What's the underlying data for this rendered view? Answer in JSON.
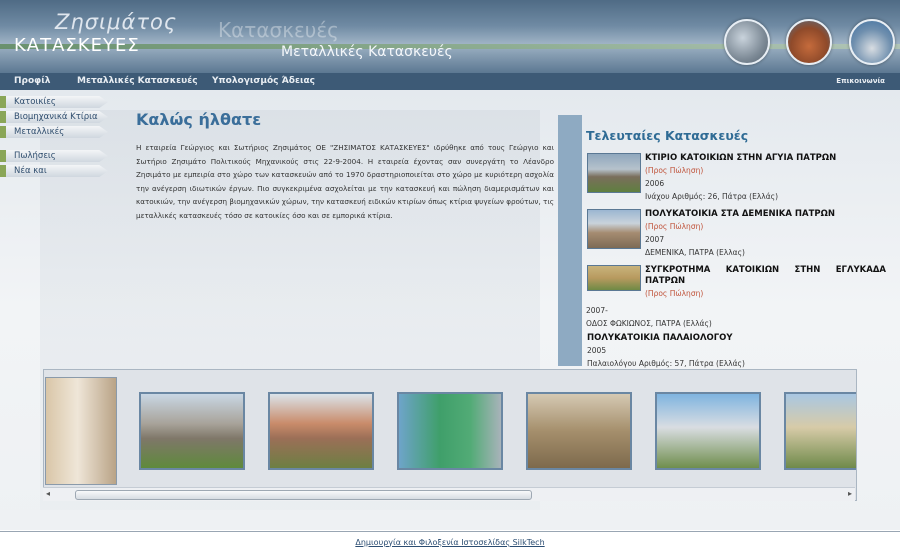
{
  "header": {
    "logo_top": "Ζησιμάτος",
    "logo_bottom": "ΚΑΤΑΣΚΕΥΕΣ",
    "ghost_title": "Κατασκευές",
    "subtitle": "Μεταλλικές Κατασκευές"
  },
  "nav": {
    "items": [
      "Προφίλ",
      "Μεταλλικές Κατασκευές",
      "Υπολογισμός Άδειας"
    ],
    "contact": "Επικοινωνία"
  },
  "sidebar": {
    "items": [
      "Κατοικίες",
      "Βιομηχανικά Κτίρια",
      "Μεταλλικές Κατασκευές",
      "Πωλήσεις",
      "Νέα και Ανακοινώσεις"
    ]
  },
  "main": {
    "title": "Καλώς ήλθατε",
    "body": "Η εταιρεία Γεώργιος και Σωτήριος Ζησιμάτος ΟΕ \"ΖΗΣΙΜΑΤΟΣ ΚΑΤΑΣΚΕΥΕΣ\" ιδρύθηκε από τους Γεώργιο και Σωτήριο Ζησιμάτο Πολιτικούς Μηχανικούς στις 22-9-2004. Η εταιρεία έχοντας σαν συνεργάτη το Λέανδρο Ζησιμάτο με εμπειρία στο χώρο των κατασκευών από το 1970 δραστηριοποιείται στο χώρο με κυριότερη ασχολία την ανέγερση ιδιωτικών έργων. Πιο συγκεκριμένα ασχολείται με την κατασκευή και πώληση διαμερισμάτων και κατοικιών, την ανέγερση βιομηχανικών χώρων, την κατασκευή ειδικών κτιρίων όπως κτίρια ψυγείων φρούτων, τις μεταλλικές κατασκευές τόσο σε κατοικίες όσο και σε εμπορικά κτίρια."
  },
  "recent": {
    "title": "Τελευταίες Κατασκευές",
    "projects": [
      {
        "title": "ΚΤΙΡΙΟ ΚΑΤΟΙΚΙΩΝ ΣΤΗΝ ΑΓΥΙΑ ΠΑΤΡΩΝ",
        "sale": "(Προς Πώληση)",
        "year": "2006",
        "address": "Ινάχου Αριθμός: 26, Πάτρα (Ελλάς)"
      },
      {
        "title": "ΠΟΛΥΚΑΤΟΙΚΙΑ ΣΤΑ ΔΕΜΕΝΙΚΑ ΠΑΤΡΩΝ",
        "sale": "(Προς Πώληση)",
        "year": "2007",
        "address": "ΔΕΜΕΝΙΚΑ, ΠΑΤΡΑ (Ελλας)"
      },
      {
        "title": "ΣΥΓΚΡΟΤΗΜΑ ΚΑΤΟΙΚΙΩΝ ΣΤΗΝ ΕΓΛΥΚΑΔΑ ΠΑΤΡΩΝ",
        "sale": "(Προς Πώληση)",
        "year": "2007-",
        "address": "ΟΔΟΣ ΦΩΚΙΩΝΟΣ, ΠΑΤΡΑ (Ελλάς)"
      },
      {
        "title": "ΠΟΛΥΚΑΤΟΙΚΙΑ ΠΑΛΑΙΟΛΟΓΟΥ",
        "year": "2005",
        "address": "Παλαιολόγου Αριθμός: 57, Πάτρα (Ελλάς)"
      }
    ]
  },
  "colors": {
    "accent": "#3a6e9a",
    "sale": "#c0533a",
    "nav": "#3d5a76",
    "sidebar_marker": "#8aa657"
  },
  "footer": {
    "text": "Δημιουργία και Φιλοξενία Ιστοσελίδας SilkTech"
  }
}
